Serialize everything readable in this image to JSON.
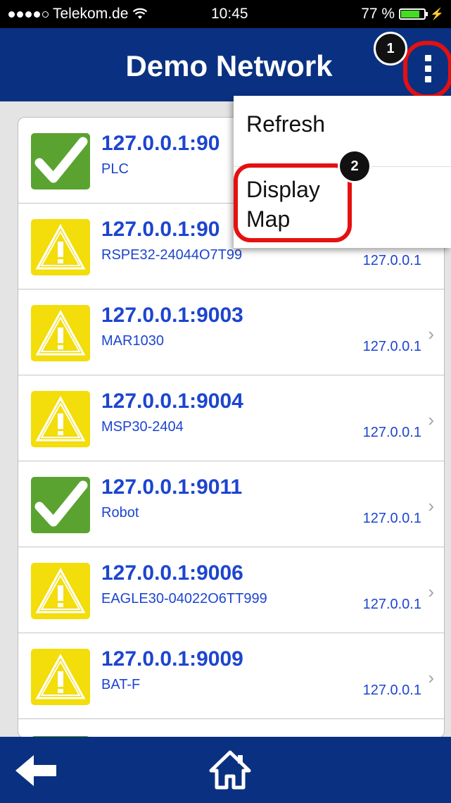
{
  "status_bar": {
    "carrier": "Telekom.de",
    "time": "10:45",
    "battery": "77 %"
  },
  "header": {
    "title": "Demo Network",
    "callout_1": "1",
    "callout_2": "2"
  },
  "menu": {
    "refresh": "Refresh",
    "display_map": "Display Map"
  },
  "devices": [
    {
      "address": "127.0.0.1:90",
      "name": "PLC",
      "ip": "",
      "status": "ok"
    },
    {
      "address": "127.0.0.1:90",
      "name": "RSPE32-24044O7T99",
      "ip": "127.0.0.1",
      "status": "warning"
    },
    {
      "address": "127.0.0.1:9003",
      "name": "MAR1030",
      "ip": "127.0.0.1",
      "status": "warning"
    },
    {
      "address": "127.0.0.1:9004",
      "name": "MSP30-2404",
      "ip": "127.0.0.1",
      "status": "warning"
    },
    {
      "address": "127.0.0.1:9011",
      "name": "Robot",
      "ip": "127.0.0.1",
      "status": "ok"
    },
    {
      "address": "127.0.0.1:9006",
      "name": "EAGLE30-04022O6TT999",
      "ip": "127.0.0.1",
      "status": "warning"
    },
    {
      "address": "127.0.0.1:9009",
      "name": "BAT-F",
      "ip": "127.0.0.1",
      "status": "warning"
    }
  ],
  "colors": {
    "nav_blue": "#0a3181",
    "link_blue": "#1d45cf",
    "ok_green": "#5aa330",
    "warn_yellow": "#f3dd0a",
    "highlight_red": "#e51010"
  },
  "icons": {
    "back": "back-arrow-icon",
    "home": "home-icon",
    "menu": "kebab-menu-icon",
    "ok": "checkmark-icon",
    "warning": "warning-triangle-icon"
  }
}
